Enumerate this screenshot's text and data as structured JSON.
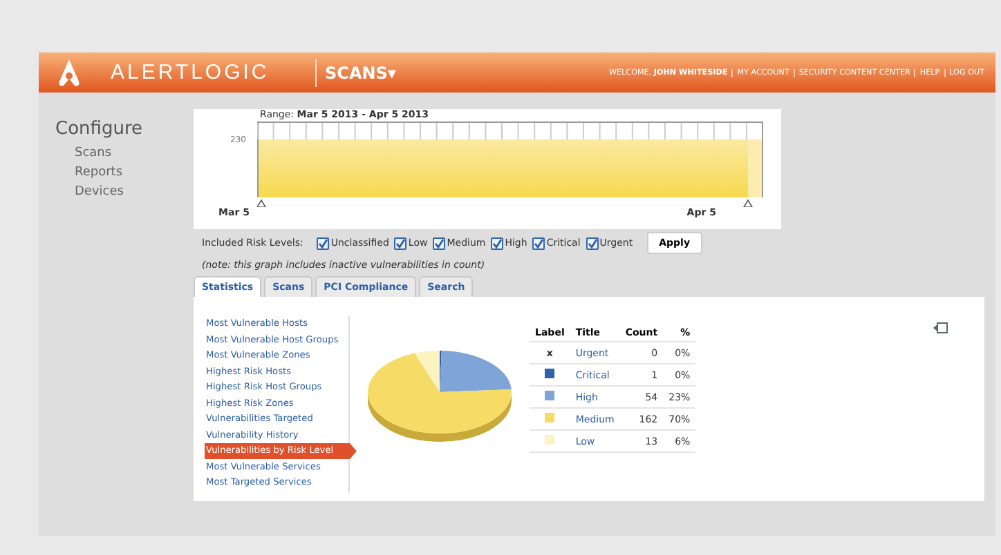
{
  "header": {
    "brand": "ALERTLOGIC",
    "section": "SCANS",
    "section_caret": "▾",
    "welcome": "WELCOME,",
    "user": "JOHN WHITESIDE",
    "links": [
      "MY ACCOUNT",
      "SECURITY CONTENT CENTER",
      "HELP",
      "LOG OUT"
    ]
  },
  "sidebar": {
    "title": "Configure",
    "items": [
      "Scans",
      "Reports",
      "Devices"
    ]
  },
  "range": {
    "label": "Range:",
    "value": "Mar 5 2013 - Apr 5 2013",
    "y_tick": "230",
    "start": "Mar 5",
    "end": "Apr 5"
  },
  "filters": {
    "label": "Included Risk Levels:",
    "options": [
      {
        "label": "Unclassified",
        "checked": true
      },
      {
        "label": "Low",
        "checked": true
      },
      {
        "label": "Medium",
        "checked": true
      },
      {
        "label": "High",
        "checked": true
      },
      {
        "label": "Critical",
        "checked": true
      },
      {
        "label": "Urgent",
        "checked": true
      }
    ],
    "apply": "Apply",
    "note": "(note: this graph includes inactive vulnerabilities in count)"
  },
  "tabs": [
    {
      "label": "Statistics",
      "selected": true
    },
    {
      "label": "Scans",
      "selected": false
    },
    {
      "label": "PCI Compliance",
      "selected": false
    },
    {
      "label": "Search",
      "selected": false
    }
  ],
  "reports": [
    {
      "label": "Most Vulnerable Hosts",
      "selected": false
    },
    {
      "label": "Most Vulnerable Host Groups",
      "selected": false
    },
    {
      "label": "Most Vulnerable Zones",
      "selected": false
    },
    {
      "label": "Highest Risk Hosts",
      "selected": false
    },
    {
      "label": "Highest Risk Host Groups",
      "selected": false
    },
    {
      "label": "Highest Risk Zones",
      "selected": false
    },
    {
      "label": "Vulnerabilities Targeted",
      "selected": false
    },
    {
      "label": "Vulnerability History",
      "selected": false
    },
    {
      "label": "Vulnerabilities by Risk Level",
      "selected": true
    },
    {
      "label": "Most Vulnerable Services",
      "selected": false
    },
    {
      "label": "Most Targeted Services",
      "selected": false
    }
  ],
  "table": {
    "columns": [
      "Label",
      "Title",
      "Count",
      "%"
    ],
    "rows": [
      {
        "kind": "mark",
        "mark": "x",
        "title": "Urgent",
        "count": "0",
        "percent": "0%"
      },
      {
        "kind": "swatch",
        "color": "#2f62a8",
        "title": "Critical",
        "count": "1",
        "percent": "0%"
      },
      {
        "kind": "swatch",
        "color": "#7ea4d8",
        "title": "High",
        "count": "54",
        "percent": "23%"
      },
      {
        "kind": "swatch",
        "color": "#f6dc66",
        "title": "Medium",
        "count": "162",
        "percent": "70%"
      },
      {
        "kind": "swatch",
        "color": "#fdf3c0",
        "title": "Low",
        "count": "13",
        "percent": "6%"
      }
    ]
  }
}
